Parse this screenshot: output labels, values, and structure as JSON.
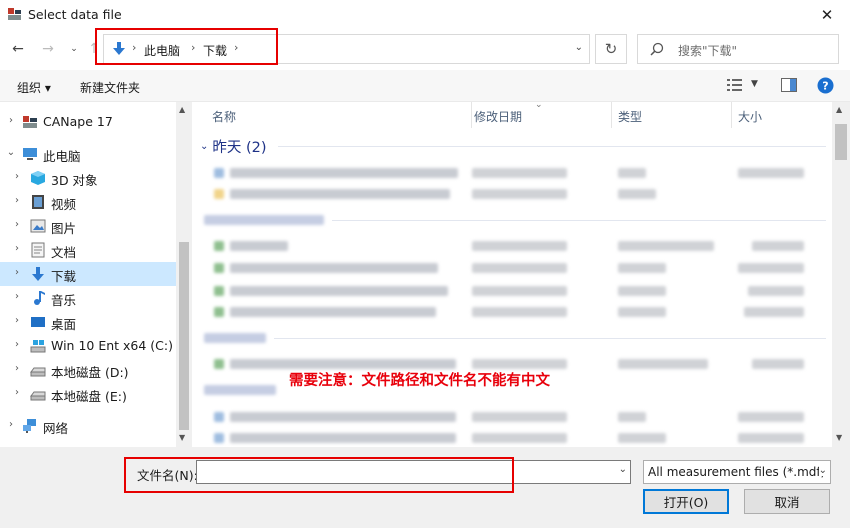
{
  "window": {
    "title": "Select data file"
  },
  "address": {
    "crumbs": [
      "此电脑",
      "下载"
    ]
  },
  "search": {
    "placeholder": "搜索\"下载\""
  },
  "toolbar": {
    "organize": "组织 ▾",
    "new_folder": "新建文件夹"
  },
  "sidebar": {
    "items": [
      {
        "label": "CANape 17",
        "icon": "canape-icon",
        "arrow": "›"
      },
      {
        "label": "此电脑",
        "icon": "computer-icon",
        "arrow": "⌄"
      },
      {
        "label": "3D 对象",
        "icon": "cube-icon",
        "arrow": "›"
      },
      {
        "label": "视频",
        "icon": "video-icon",
        "arrow": "›"
      },
      {
        "label": "图片",
        "icon": "pictures-icon",
        "arrow": "›"
      },
      {
        "label": "文档",
        "icon": "documents-icon",
        "arrow": "›"
      },
      {
        "label": "下载",
        "icon": "download-icon",
        "arrow": "›"
      },
      {
        "label": "音乐",
        "icon": "music-icon",
        "arrow": "›"
      },
      {
        "label": "桌面",
        "icon": "desktop-icon",
        "arrow": "›"
      },
      {
        "label": "Win 10 Ent x64 (C:)",
        "icon": "system-drive-icon",
        "arrow": "›"
      },
      {
        "label": "本地磁盘 (D:)",
        "icon": "drive-icon",
        "arrow": "›"
      },
      {
        "label": "本地磁盘 (E:)",
        "icon": "drive-icon",
        "arrow": "›"
      },
      {
        "label": "网络",
        "icon": "network-icon",
        "arrow": "›"
      }
    ]
  },
  "columns": {
    "name": "名称",
    "date": "修改日期",
    "type": "类型",
    "size": "大小"
  },
  "groups": {
    "yesterday": "昨天 (2)"
  },
  "annotation": {
    "note": "需要注意：文件路径和文件名不能有中文"
  },
  "bottom": {
    "filename_label": "文件名(N):",
    "filename_value": "",
    "filter_value": "All measurement files (*.mdf;",
    "open_label": "打开(O)",
    "cancel_label": "取消"
  },
  "colors": {
    "accent": "#0078d7",
    "annotation": "#e60000",
    "selection": "#cce8ff",
    "group": "#1e3287"
  }
}
